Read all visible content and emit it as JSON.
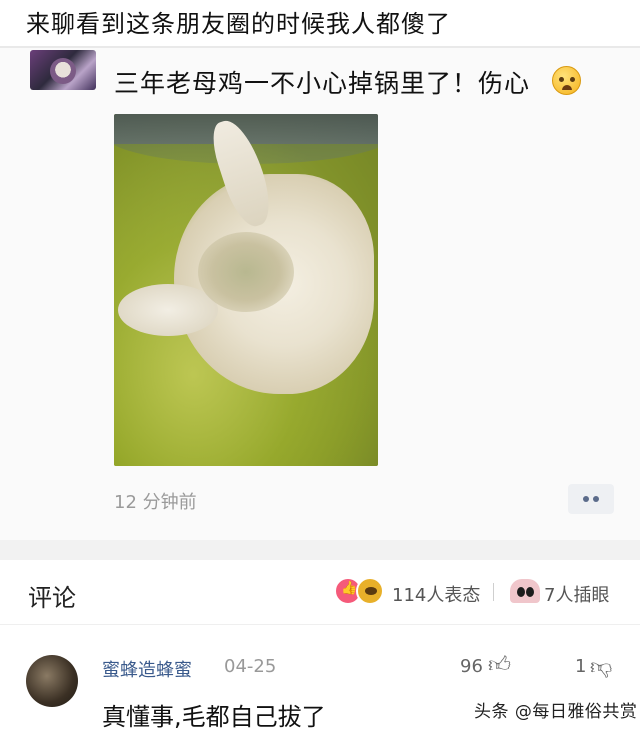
{
  "headline": "来聊看到这条朋友圈的时候我人都傻了",
  "post": {
    "text": "三年老母鸡一不小心掉锅里了！伤心",
    "time": "12 分钟前",
    "emoji": "crying-face-icon"
  },
  "comments_header": {
    "title": "评论",
    "reactions_text": "114人表态",
    "eyes_text": "7人插眼"
  },
  "comment": {
    "author": "蜜蜂造蜂蜜",
    "date": "04-25",
    "likes": "96",
    "dislikes": "1",
    "text": "真懂事,毛都自己拔了"
  },
  "watermark": "头条 @每日雅俗共赏",
  "colors": {
    "author_link": "#3a5a8c",
    "like_badge": "#f55a7a",
    "more_button_dots": "#5b6b8a"
  }
}
